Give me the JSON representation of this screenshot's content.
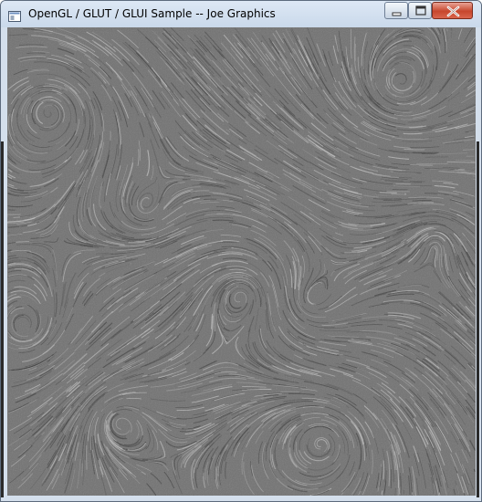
{
  "window": {
    "title": "OpenGL / GLUT / GLUI Sample -- Joe Graphics",
    "icon": "opengl-app-icon",
    "controls": {
      "minimize_icon": "minimize-icon",
      "maximize_icon": "maximize-icon",
      "close_icon": "close-icon"
    }
  },
  "canvas": {
    "content": "line-integral-convolution-flow-visualization",
    "background_color": "#727272",
    "streak_color": "#c8c8c8"
  }
}
